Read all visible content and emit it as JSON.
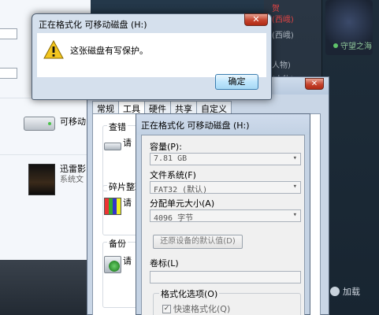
{
  "background": {
    "middle_items": [
      "贺",
      "(西峨)",
      "(西峨)",
      "人物)",
      "(人物)"
    ],
    "chat_status": "守望之海",
    "chat_add": "加载"
  },
  "explorer": {
    "device_label": "可移动",
    "app_title": "迅雷影",
    "app_sub": "系统文"
  },
  "properties": {
    "tabs": [
      "常规",
      "工具",
      "硬件",
      "共享",
      "自定义"
    ],
    "groups": [
      {
        "label": "查错",
        "cut": "请"
      },
      {
        "label": "碎片整理",
        "cut": "请"
      },
      {
        "label": "备份",
        "cut": "请"
      }
    ],
    "close_label": "✕"
  },
  "format_dialog": {
    "title": "正在格式化 可移动磁盘 (H:)",
    "capacity_label": "容量(P):",
    "capacity_value": "7.81 GB",
    "fs_label": "文件系统(F)",
    "fs_value": "FAT32 (默认)",
    "alloc_label": "分配单元大小(A)",
    "alloc_value": "4096 字节",
    "restore_button": "还原设备的默认值(D)",
    "volume_label": "卷标(L)",
    "volume_value": "",
    "options_label": "格式化选项(O)",
    "quick_format": "快速格式化(Q)"
  },
  "message_box": {
    "title": "正在格式化 可移动磁盘 (H:)",
    "text": "这张磁盘有写保护。",
    "ok_button": "确定",
    "close_label": "✕"
  }
}
